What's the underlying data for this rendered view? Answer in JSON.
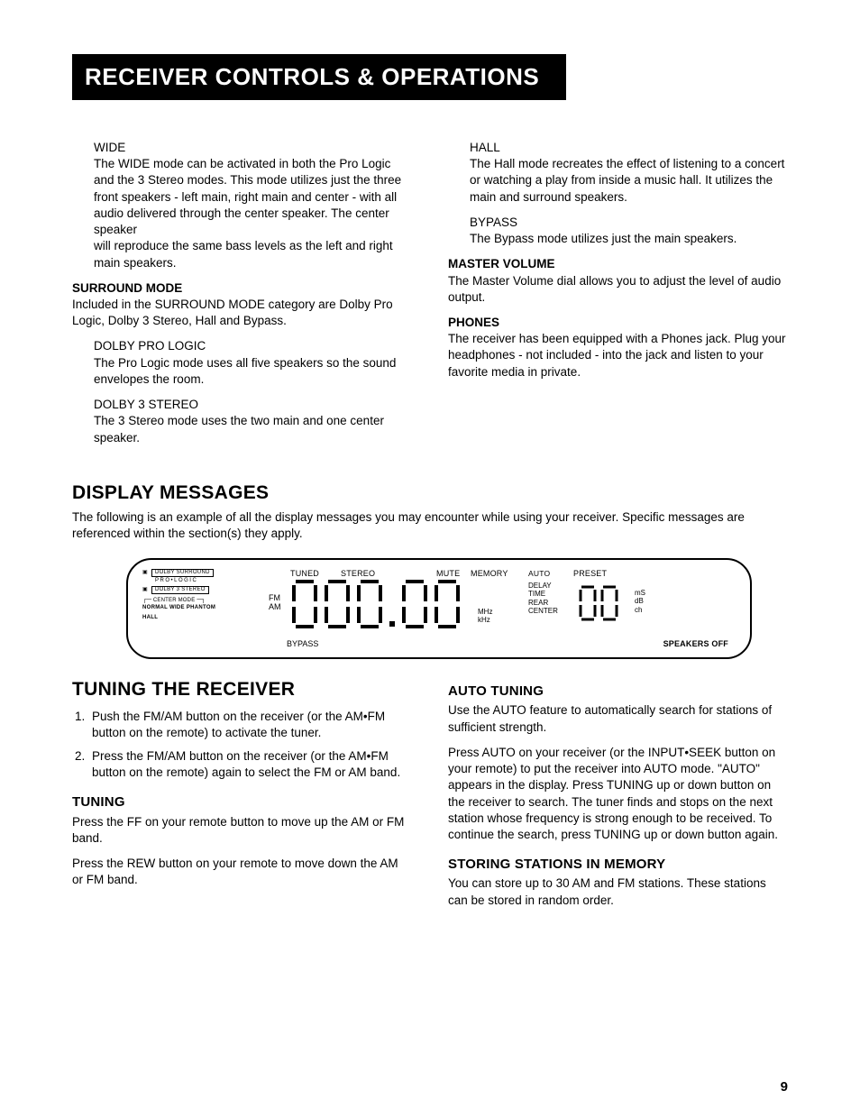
{
  "title": "RECEIVER CONTROLS & OPERATIONS",
  "left": {
    "wide": {
      "label": "WIDE",
      "body1": "The WIDE mode can be activated in both the Pro Logic and the 3 Stereo modes. This mode utilizes just the three front speakers - left main, right main and center - with all audio delivered through the center speaker. The center speaker",
      "body2": "will reproduce the same bass levels as the left and right main speakers."
    },
    "surround": {
      "label": "SURROUND MODE",
      "body": "Included in the SURROUND MODE category are Dolby Pro Logic, Dolby 3 Stereo, Hall and Bypass."
    },
    "prologic": {
      "label": "DOLBY PRO LOGIC",
      "body": "The Pro Logic mode uses all five speakers so the sound envelopes the room."
    },
    "d3stereo": {
      "label": "DOLBY 3 STEREO",
      "body": "The 3 Stereo mode uses the two main  and one center speaker."
    }
  },
  "right": {
    "hall": {
      "label": "HALL",
      "body": "The Hall mode recreates the effect of listening to a concert or watching a play from inside a music hall. It utilizes the main and surround speakers."
    },
    "bypass": {
      "label": "BYPASS",
      "body": "The Bypass mode utilizes just the main speakers."
    },
    "master": {
      "label": "MASTER VOLUME",
      "body": "The Master Volume dial allows you to adjust the level of audio output."
    },
    "phones": {
      "label": "PHONES",
      "body": "The receiver has been equipped with a Phones jack. Plug your headphones - not included - into the jack and listen to your favorite media in private."
    }
  },
  "display_section": {
    "heading": "DISPLAY MESSAGES",
    "intro": "The following is an example of all the display messages you may encounter while using your receiver. Specific messages are referenced within the section(s) they apply."
  },
  "display_panel": {
    "dolby_surround": "DOLBY SURROUND",
    "prologic": "PRO•LOGIC",
    "dolby3": "DOLBY 3 STEREO",
    "center_mode": "CENTER MODE",
    "cm_options": "NORMAL WIDE PHANTOM",
    "hall": "HALL",
    "fm": "FM",
    "am": "AM",
    "bypass": "BYPASS",
    "tuned": "TUNED",
    "stereo": "STEREO",
    "mute": "MUTE",
    "memory": "MEMORY",
    "auto": "AUTO",
    "preset": "PRESET",
    "delay": "DELAY",
    "time": "TIME",
    "rear": "REAR",
    "center": "CENTER",
    "ms": "mS",
    "db": "dB",
    "ch": "ch",
    "mhz": "MHz",
    "khz": "kHz",
    "speakers_off": "SPEAKERS OFF"
  },
  "tuning": {
    "heading": "TUNING THE RECEIVER",
    "step1": "Push the FM/AM button on the receiver (or the AM•FM button on the remote) to activate the tuner.",
    "step2": "Press the FM/AM button on the receiver (or the AM•FM button on the remote) again to select the FM or AM band.",
    "sub_heading": "TUNING",
    "body1": "Press the FF on your remote button to move up the AM or FM band.",
    "body2": "Press the REW button on your remote to move down the AM or FM band."
  },
  "auto": {
    "heading": "AUTO TUNING",
    "body1": "Use the AUTO feature to automatically search for stations of sufficient strength.",
    "body2": "Press AUTO on your receiver (or the INPUT•SEEK button on your remote) to put the receiver into AUTO mode. \"AUTO\" appears in the display. Press TUNING up or down button on the receiver to search. The tuner finds and stops on the next station whose frequency is strong enough to be received. To continue the search, press TUNING up or down button again."
  },
  "storing": {
    "heading": "STORING STATIONS IN MEMORY",
    "body": "You can store up to 30 AM and FM stations. These stations can be stored in random order."
  },
  "page_number": "9"
}
